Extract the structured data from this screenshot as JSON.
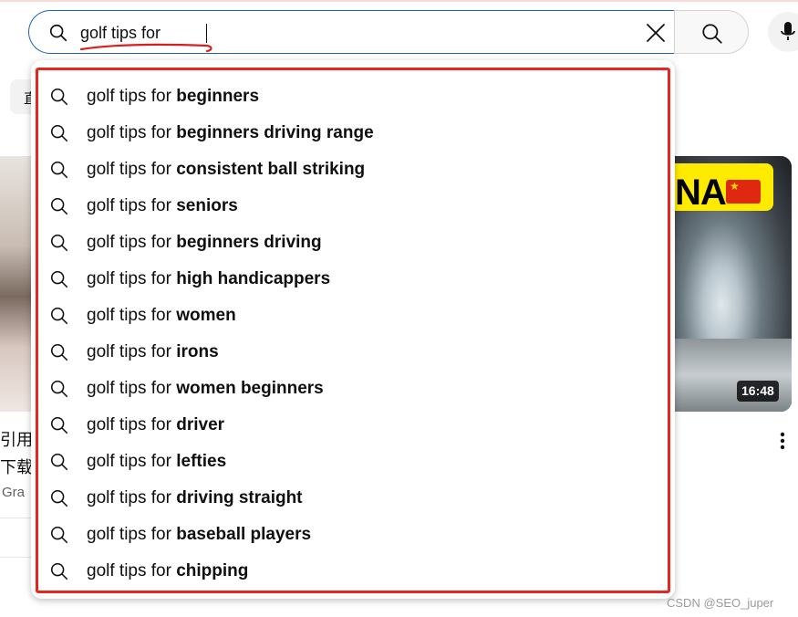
{
  "search": {
    "query": "golf tips for",
    "search_button_icon": "search-icon",
    "voice_icon": "mic-icon",
    "clear_icon": "close-icon"
  },
  "suggestions": [
    {
      "prefix": "golf tips for ",
      "completion": "beginners"
    },
    {
      "prefix": "golf tips for ",
      "completion": "beginners driving range"
    },
    {
      "prefix": "golf tips for ",
      "completion": "consistent ball striking"
    },
    {
      "prefix": "golf tips for ",
      "completion": "seniors"
    },
    {
      "prefix": "golf tips for ",
      "completion": "beginners driving"
    },
    {
      "prefix": "golf tips for ",
      "completion": "high handicappers"
    },
    {
      "prefix": "golf tips for ",
      "completion": "women"
    },
    {
      "prefix": "golf tips for ",
      "completion": "irons"
    },
    {
      "prefix": "golf tips for ",
      "completion": "women beginners"
    },
    {
      "prefix": "golf tips for ",
      "completion": "driver"
    },
    {
      "prefix": "golf tips for ",
      "completion": "lefties"
    },
    {
      "prefix": "golf tips for ",
      "completion": "driving straight"
    },
    {
      "prefix": "golf tips for ",
      "completion": "baseball players"
    },
    {
      "prefix": "golf tips for ",
      "completion": "chipping"
    }
  ],
  "background": {
    "chip_partial": "直",
    "left_title_line1": "引用",
    "left_title_line2": "下载",
    "left_channel": "Gra",
    "right_thumb_banner": "NA",
    "right_duration": "16:48"
  },
  "watermark": "CSDN @SEO_juper",
  "colors": {
    "highlight": "#e8261e",
    "focus_border": "#1c62b9",
    "underline": "#d62020"
  }
}
